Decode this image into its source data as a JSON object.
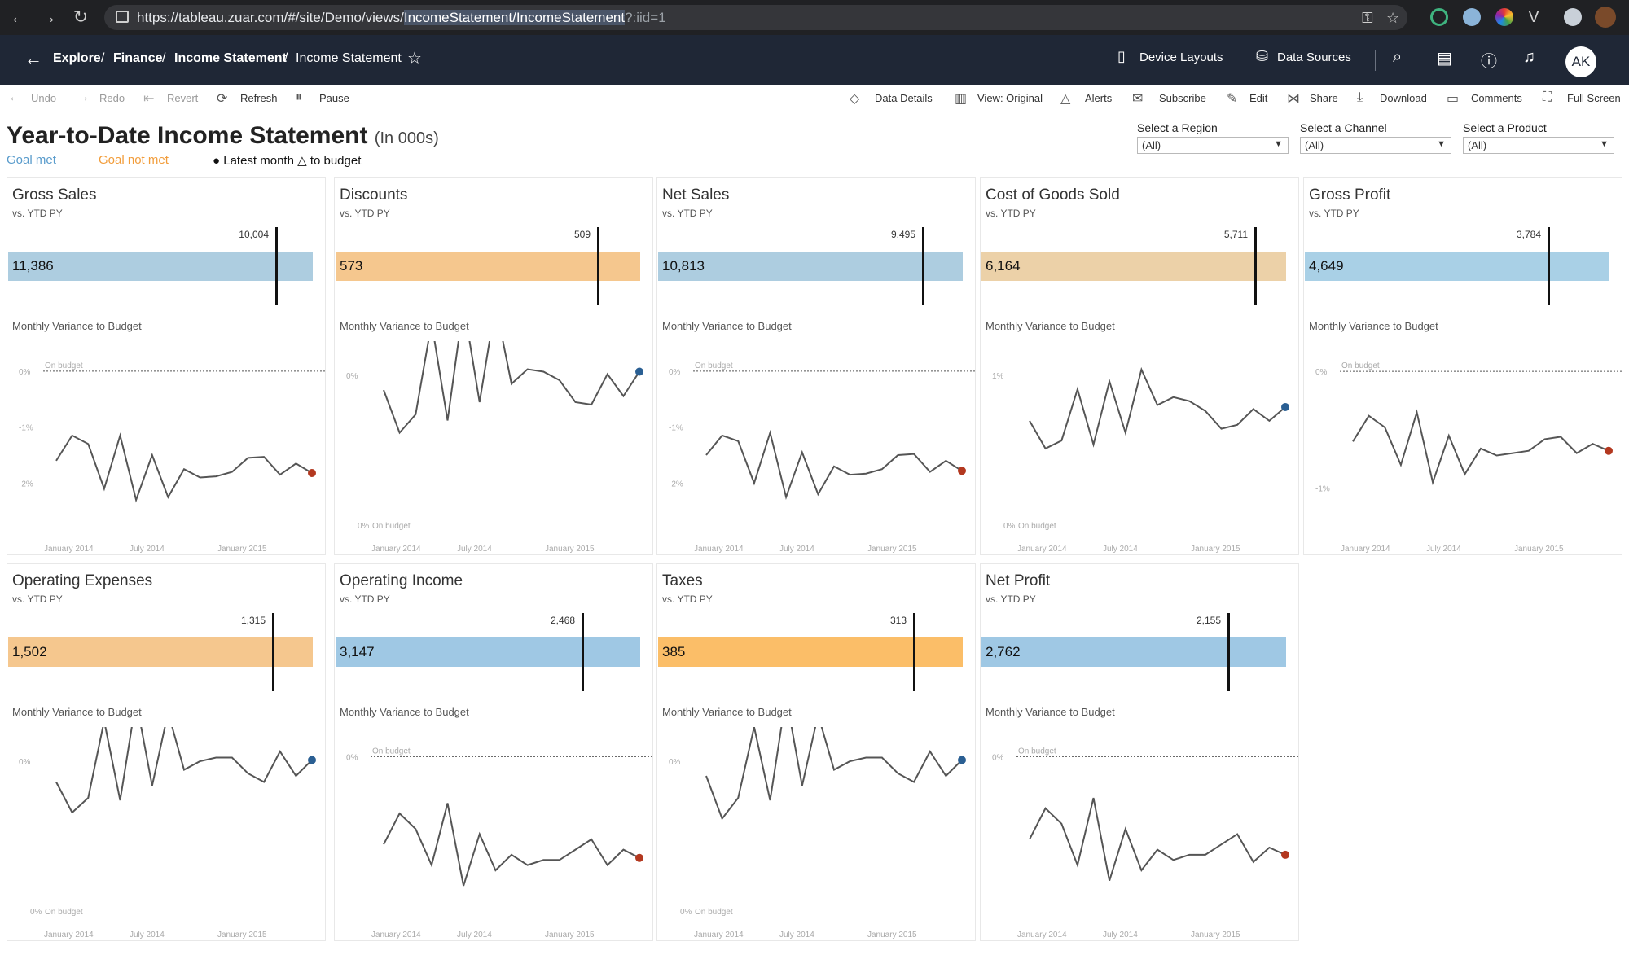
{
  "browser": {
    "url_prefix": "https://tableau.zuar.com/#/site/Demo/views/",
    "url_highlight": "IncomeStatement/IncomeStatement",
    "url_suffix": "?:iid=1"
  },
  "header": {
    "breadcrumbs": [
      "Explore",
      "Finance",
      "Income Statement",
      "Income Statement"
    ],
    "device_layouts": "Device Layouts",
    "data_sources": "Data Sources",
    "avatar": "AK"
  },
  "toolbar": {
    "undo": "Undo",
    "redo": "Redo",
    "revert": "Revert",
    "refresh": "Refresh",
    "pause": "Pause",
    "data_details": "Data Details",
    "view": "View: Original",
    "alerts": "Alerts",
    "subscribe": "Subscribe",
    "edit": "Edit",
    "share": "Share",
    "download": "Download",
    "comments": "Comments",
    "full_screen": "Full Screen"
  },
  "dashboard": {
    "title": "Year-to-Date Income Statement",
    "subtitle": "(In 000s)",
    "legend": {
      "goal_met": "Goal met",
      "goal_not_met": "Goal not met",
      "latest": "● Latest month △ to budget"
    },
    "colors": {
      "goal_met": "#6aa2cc",
      "goal_not_met": "#f6a84a",
      "latest_good": "#2a5f93",
      "latest_bad": "#b3381f"
    }
  },
  "filters": [
    {
      "label": "Select a Region",
      "value": "(All)"
    },
    {
      "label": "Select a Channel",
      "value": "(All)"
    },
    {
      "label": "Select a Product",
      "value": "(All)"
    }
  ],
  "common": {
    "vs": "vs. YTD PY",
    "monthly": "Monthly Variance to Budget",
    "on_budget": "On budget",
    "x_ticks": [
      "January 2014",
      "July 2014",
      "January 2015"
    ]
  },
  "panels": [
    {
      "title": "Gross Sales",
      "value": "11,386",
      "target": "10,004",
      "bar_color": "#adcde0",
      "bar_fraction": 0.965,
      "target_fraction": 0.847,
      "y_labels": [
        "0%",
        "-1%",
        "-2%"
      ],
      "ylim": [
        -2.3,
        0.1
      ],
      "on_budget_y": 0,
      "series": [
        -1.6,
        -1.15,
        -1.3,
        -2.1,
        -1.15,
        -2.3,
        -1.5,
        -2.25,
        -1.75,
        -1.9,
        -1.88,
        -1.8,
        -1.55,
        -1.53,
        -1.85,
        -1.65,
        -1.82
      ],
      "end": "bad"
    },
    {
      "title": "Discounts",
      "value": "573",
      "target": "509",
      "bar_color": "#f5c78e",
      "bar_fraction": 0.965,
      "target_fraction": 0.83,
      "y_labels": [
        "0%"
      ],
      "ylim": [
        -0.9,
        0.2
      ],
      "on_budget_y": -0.85,
      "on_budget_bottom": true,
      "series": [
        0,
        -0.35,
        -0.2,
        0.55,
        -0.25,
        0.7,
        -0.1,
        0.7,
        0.05,
        0.17,
        0.15,
        0.08,
        -0.1,
        -0.12,
        0.13,
        -0.05,
        0.15
      ],
      "end": "good"
    },
    {
      "title": "Net Sales",
      "value": "10,813",
      "target": "9,495",
      "bar_color": "#adcde0",
      "bar_fraction": 0.965,
      "target_fraction": 0.838,
      "y_labels": [
        "0%",
        "-1%",
        "-2%"
      ],
      "ylim": [
        -2.3,
        0.1
      ],
      "on_budget_y": 0,
      "series": [
        -1.5,
        -1.15,
        -1.25,
        -2.0,
        -1.1,
        -2.25,
        -1.45,
        -2.2,
        -1.7,
        -1.85,
        -1.83,
        -1.75,
        -1.5,
        -1.48,
        -1.8,
        -1.6,
        -1.78
      ],
      "end": "bad"
    },
    {
      "title": "Cost of Goods Sold",
      "value": "6,164",
      "target": "5,711",
      "bar_color": "#ecd1a8",
      "bar_fraction": 0.965,
      "target_fraction": 0.865,
      "y_labels": [
        "1%"
      ],
      "ylim": [
        -1.3,
        2.1
      ],
      "on_budget_y": -1.2,
      "on_budget_bottom": true,
      "series": [
        0.7,
        0.0,
        0.2,
        1.5,
        0.1,
        1.7,
        0.4,
        2.0,
        1.1,
        1.3,
        1.2,
        0.95,
        0.5,
        0.6,
        1.0,
        0.7,
        1.05
      ],
      "end": "good"
    },
    {
      "title": "Gross Profit",
      "value": "4,649",
      "target": "3,784",
      "bar_color": "#a9d0e6",
      "bar_fraction": 0.965,
      "target_fraction": 0.77,
      "y_labels": [
        "0%",
        "-1%"
      ],
      "ylim": [
        -1.1,
        0.05
      ],
      "on_budget_y": 0,
      "series": [
        -0.6,
        -0.38,
        -0.48,
        -0.8,
        -0.35,
        -0.95,
        -0.55,
        -0.88,
        -0.66,
        -0.72,
        -0.7,
        -0.68,
        -0.58,
        -0.56,
        -0.7,
        -0.62,
        -0.68
      ],
      "end": "bad"
    },
    {
      "title": "Operating Expenses",
      "value": "1,502",
      "target": "1,315",
      "bar_color": "#f5c78e",
      "bar_fraction": 0.965,
      "target_fraction": 0.838,
      "y_labels": [
        "0%"
      ],
      "ylim": [
        -0.9,
        0.2
      ],
      "on_budget_y": -0.85,
      "on_budget_bottom": true,
      "series": [
        -0.05,
        -0.3,
        -0.18,
        0.45,
        -0.2,
        0.62,
        -0.08,
        0.52,
        0.05,
        0.12,
        0.15,
        0.15,
        0.02,
        -0.05,
        0.2,
        0.0,
        0.13
      ],
      "end": "good"
    },
    {
      "title": "Operating Income",
      "value": "3,147",
      "target": "2,468",
      "bar_color": "#9fc8e4",
      "bar_fraction": 0.965,
      "target_fraction": 0.78,
      "y_labels": [
        "0%"
      ],
      "ylim": [
        -1.25,
        0.05
      ],
      "on_budget_y": 0,
      "series": [
        -0.85,
        -0.55,
        -0.7,
        -1.05,
        -0.45,
        -1.25,
        -0.75,
        -1.1,
        -0.95,
        -1.05,
        -1.0,
        -1.0,
        -0.9,
        -0.8,
        -1.05,
        -0.9,
        -0.98
      ],
      "end": "bad"
    },
    {
      "title": "Taxes",
      "value": "385",
      "target": "313",
      "bar_color": "#fbbe68",
      "bar_fraction": 0.965,
      "target_fraction": 0.81,
      "y_labels": [
        "0%"
      ],
      "ylim": [
        -0.9,
        0.2
      ],
      "on_budget_y": -0.85,
      "on_budget_bottom": true,
      "series": [
        0.0,
        -0.35,
        -0.18,
        0.4,
        -0.2,
        0.65,
        -0.08,
        0.5,
        0.05,
        0.12,
        0.15,
        0.15,
        0.02,
        -0.05,
        0.2,
        0.0,
        0.13
      ],
      "end": "good"
    },
    {
      "title": "Net Profit",
      "value": "2,762",
      "target": "2,155",
      "bar_color": "#9fc8e4",
      "bar_fraction": 0.965,
      "target_fraction": 0.78,
      "y_labels": [
        "0%"
      ],
      "ylim": [
        -1.25,
        0.05
      ],
      "on_budget_y": 0,
      "series": [
        -0.8,
        -0.5,
        -0.65,
        -1.05,
        -0.4,
        -1.2,
        -0.7,
        -1.1,
        -0.9,
        -1.0,
        -0.95,
        -0.95,
        -0.85,
        -0.75,
        -1.02,
        -0.88,
        -0.95
      ],
      "end": "bad"
    }
  ]
}
